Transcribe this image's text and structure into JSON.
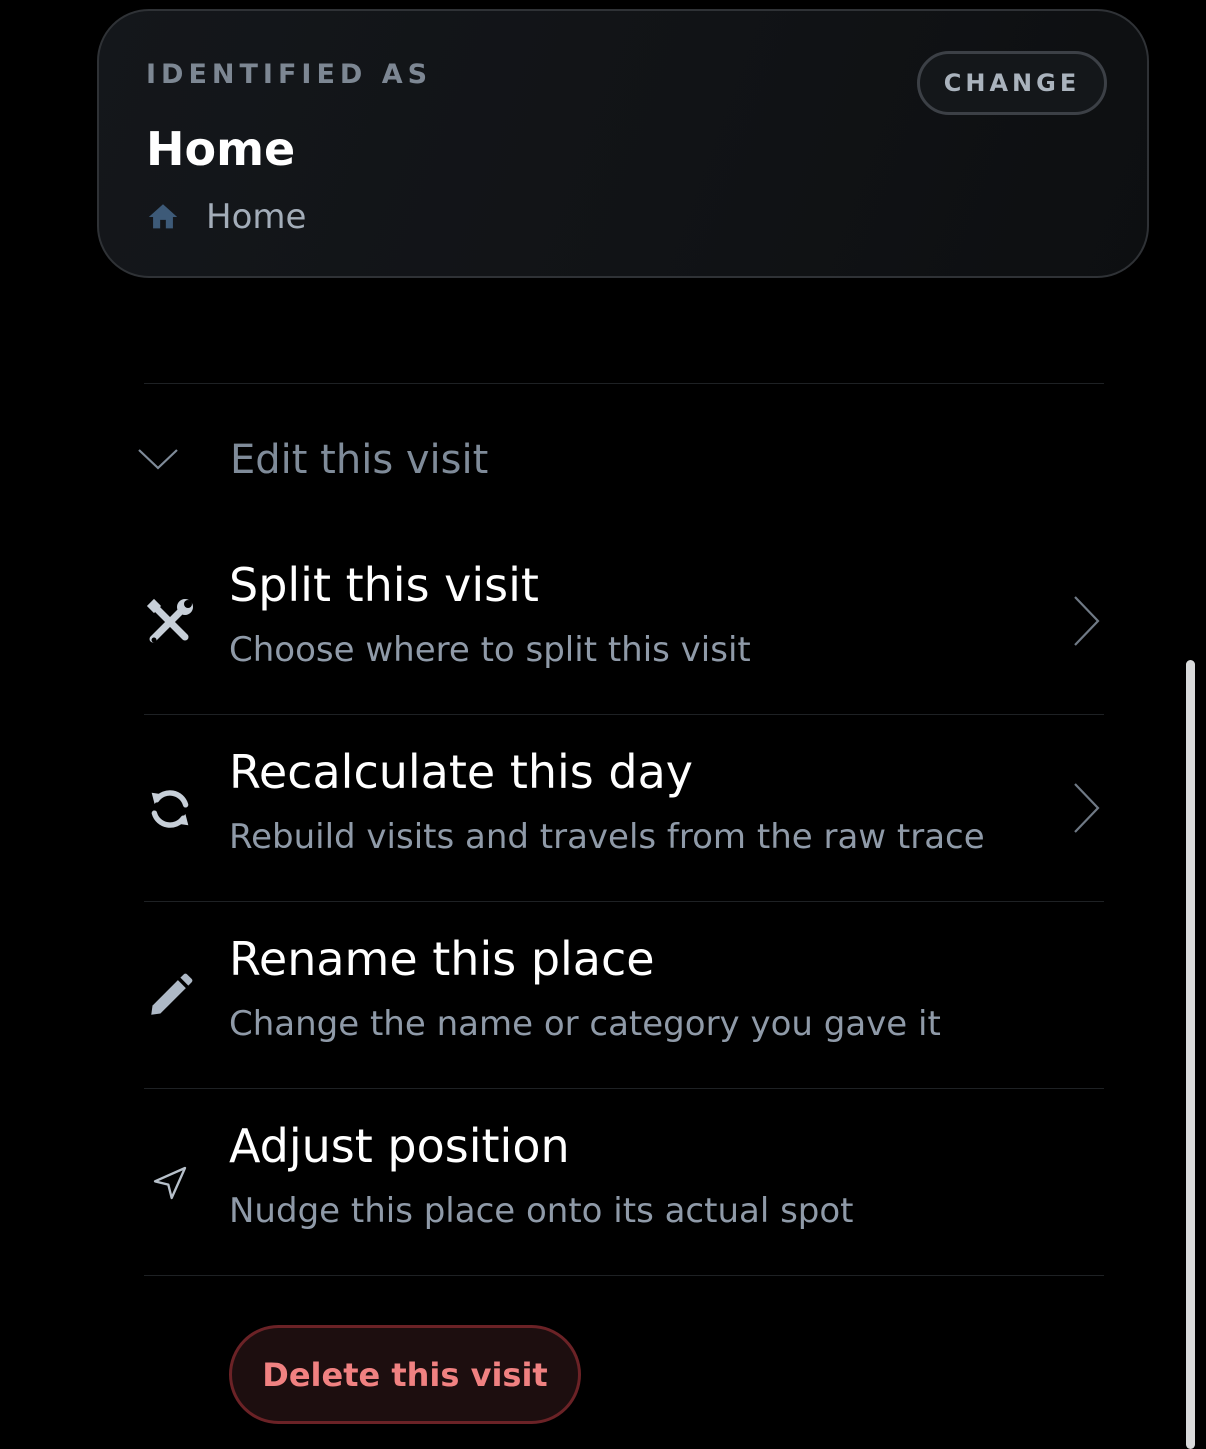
{
  "identified": {
    "eyebrow": "IDENTIFIED AS",
    "title": "Home",
    "category_icon": "home-icon",
    "category_label": "Home",
    "change_label": "CHANGE"
  },
  "edit_section": {
    "toggle_icon": "chevron-down-icon",
    "label": "Edit this visit"
  },
  "actions": [
    {
      "icon": "tools-icon",
      "title": "Split this visit",
      "description": "Choose where to split this visit",
      "has_chevron": true
    },
    {
      "icon": "refresh-icon",
      "title": "Recalculate this day",
      "description": "Rebuild visits and travels from the raw trace",
      "has_chevron": true
    },
    {
      "icon": "pencil-icon",
      "title": "Rename this place",
      "description": "Change the name or category you gave it",
      "has_chevron": false
    },
    {
      "icon": "location-arrow-icon",
      "title": "Adjust position",
      "description": "Nudge this place onto its actual spot",
      "has_chevron": false
    }
  ],
  "delete_label": "Delete this visit",
  "colors": {
    "background": "#000000",
    "card_bg": "#121417",
    "muted_text": "#8f9aa8",
    "icon_blue": "#3d5a78",
    "danger": "#f08181"
  }
}
